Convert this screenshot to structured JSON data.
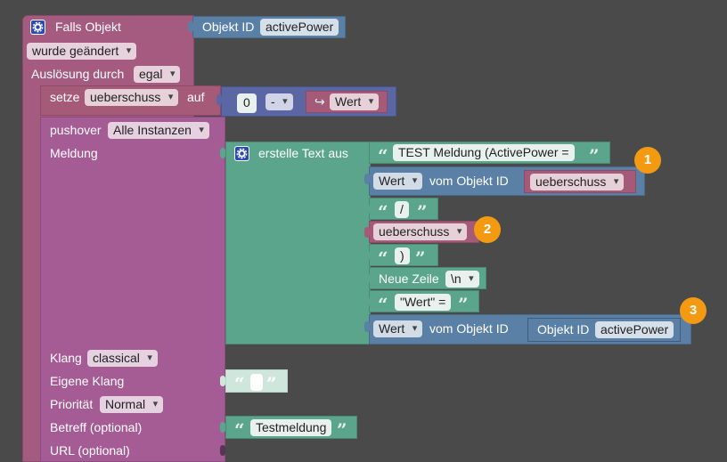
{
  "event_block": {
    "title": "Falls Objekt",
    "trigger_value": "wurde geändert",
    "ausloesung_label": "Auslösung durch",
    "ausloesung_value": "egal",
    "object_id_label": "Objekt ID",
    "object_id_value": "activePower"
  },
  "set_block": {
    "setze_label": "setze",
    "variable": "ueberschuss",
    "auf_label": "auf",
    "number_value": "0",
    "operator": "-",
    "wert_value": "Wert",
    "arrow_glyph": "↪"
  },
  "pushover_block": {
    "label": "pushover",
    "instance_value": "Alle Instanzen",
    "meldung_label": "Meldung",
    "klang_label": "Klang",
    "klang_value": "classical",
    "eigene_klang_label": "Eigene Klang",
    "prioritaet_label": "Priorität",
    "prioritaet_value": "Normal",
    "betreff_label": "Betreff (optional)",
    "betreff_value": "Testmeldung",
    "url_label": "URL (optional)"
  },
  "text_join": {
    "label": "erstelle Text aus",
    "items": {
      "text1": "TEST Meldung (ActivePower =",
      "get1_attr": "Wert",
      "get1_label": "vom Objekt ID",
      "get1_var": "ueberschuss",
      "text2": "/",
      "var2": "ueberschuss",
      "text3": ")",
      "newline_label": "Neue Zeile",
      "newline_value": "\\n",
      "text4": "\"Wert\" =",
      "get2_attr": "Wert",
      "get2_label": "vom Objekt ID",
      "get2_objid_label": "Objekt ID",
      "get2_objid_value": "activePower"
    }
  },
  "glyphs": {
    "open_quote": "“",
    "close_quote": "”"
  },
  "badges": [
    "1",
    "2",
    "3"
  ],
  "colors": {
    "background": "#4a4a4a",
    "event_purple": "#a55b80",
    "control_purple": "#a55b94",
    "math_blue": "#5b67a5",
    "variable_red": "#a55b78",
    "text_green": "#5ba58c",
    "id_blue": "#5b80a5",
    "badge_orange": "#f39a12"
  }
}
